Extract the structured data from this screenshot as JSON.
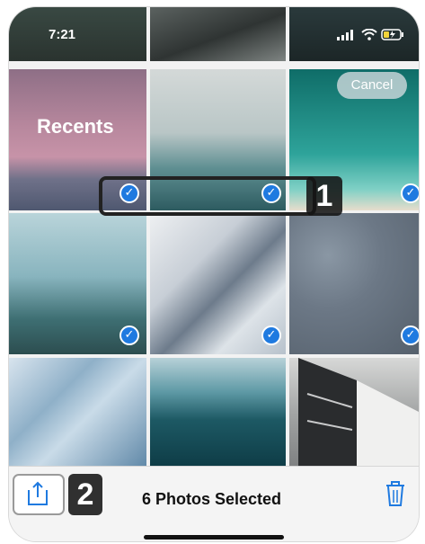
{
  "status_bar": {
    "time": "7:21"
  },
  "header": {
    "title": "Recents",
    "cancel_label": "Cancel"
  },
  "callouts": {
    "step1": "1",
    "step2": "2"
  },
  "selection": {
    "checkmark": "✓"
  },
  "toolbar": {
    "selected_text": "6 Photos Selected"
  },
  "colors": {
    "accent": "#1f7ae0",
    "callout": "#141414"
  },
  "icons": [
    "signal-icon",
    "wifi-icon",
    "battery-charging-icon",
    "share-icon",
    "trash-icon",
    "checkmark-icon"
  ]
}
